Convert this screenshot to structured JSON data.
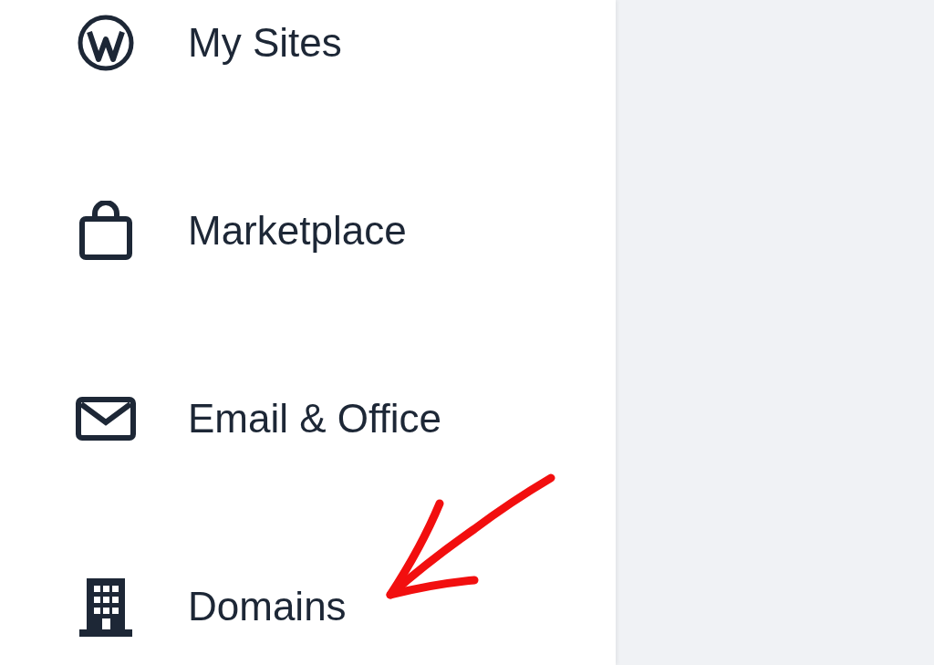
{
  "sidebar": {
    "items": [
      {
        "label": "My Sites",
        "kind": "logo"
      },
      {
        "label": "Marketplace",
        "kind": "bag"
      },
      {
        "label": "Email & Office",
        "kind": "mail"
      },
      {
        "label": "Domains",
        "kind": "building"
      }
    ]
  }
}
